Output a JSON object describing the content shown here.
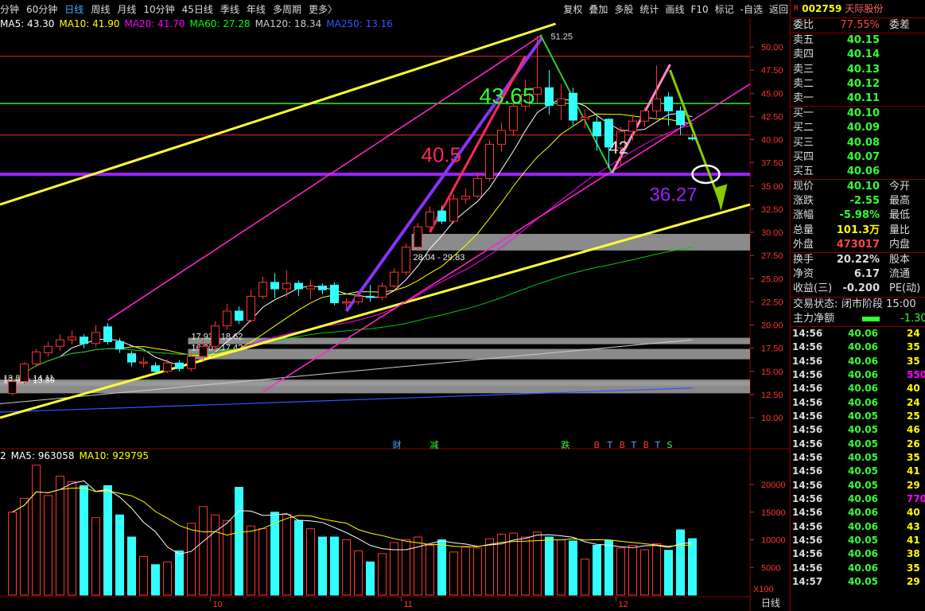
{
  "toolbar": {
    "periods": [
      "分钟",
      "60分钟",
      "日线",
      "周线",
      "月线",
      "10分钟",
      "45日线",
      "季线",
      "年线",
      "多周期",
      "更多〉"
    ],
    "active_period": "日线",
    "actions": [
      "复权",
      "叠加",
      "多股",
      "统计",
      "画线",
      "F10",
      "标记",
      "-自选",
      "返回"
    ]
  },
  "ma_legend": [
    {
      "label": "MA5: 43.30",
      "color": "#ffffff"
    },
    {
      "label": "MA10: 41.90",
      "color": "#ffff00"
    },
    {
      "label": "MA20: 41.70",
      "color": "#ff00ff"
    },
    {
      "label": "MA60: 27.28",
      "color": "#00ff00"
    },
    {
      "label": "MA120: 18.34",
      "color": "#cccccc"
    },
    {
      "label": "MA250: 13.16",
      "color": "#3355ff"
    }
  ],
  "vol_legend": [
    {
      "label": "2",
      "color": "#ffffff"
    },
    {
      "label": "MA5: 963058",
      "color": "#ffffff"
    },
    {
      "label": "MA10: 929795",
      "color": "#ffff00"
    }
  ],
  "chart_data": {
    "type": "candlestick",
    "price_axis": {
      "ticks": [
        10,
        12.5,
        15,
        17.5,
        20,
        22.5,
        25,
        27.5,
        30,
        32.5,
        35,
        37.5,
        40,
        42.5,
        45,
        47.5,
        50
      ],
      "tick_labels": [
        "10.00",
        "12.50",
        "15.00",
        "17.50",
        "20.00",
        "22.50",
        "25.00",
        "27.50",
        "30.00",
        "32.50",
        "35.00",
        "37.50",
        "40.00",
        "42.50",
        "45.00",
        "47.50",
        "50.00"
      ]
    },
    "volume_axis": {
      "ticks": [
        5000,
        10000,
        15000,
        20000
      ],
      "tick_labels": [
        "5000",
        "10000",
        "15000",
        "20000"
      ],
      "unit_label": "X100"
    },
    "x_labels": [
      {
        "label": "10",
        "index": 17
      },
      {
        "label": "11",
        "index": 33
      },
      {
        "label": "12",
        "index": 51
      }
    ],
    "period_label": "日线",
    "candles": [
      {
        "o": 12.6,
        "c": 13.9,
        "h": 14.2,
        "l": 12.4,
        "v": 15000
      },
      {
        "o": 13.9,
        "c": 15.8,
        "h": 16.0,
        "l": 13.6,
        "v": 17500
      },
      {
        "o": 15.8,
        "c": 17.1,
        "h": 17.4,
        "l": 15.5,
        "v": 23500
      },
      {
        "o": 17.0,
        "c": 17.7,
        "h": 18.2,
        "l": 16.6,
        "v": 18000
      },
      {
        "o": 17.7,
        "c": 18.4,
        "h": 19.0,
        "l": 17.2,
        "v": 21500
      },
      {
        "o": 18.4,
        "c": 18.7,
        "h": 19.4,
        "l": 17.9,
        "v": 20500
      },
      {
        "o": 18.7,
        "c": 18.0,
        "h": 19.0,
        "l": 17.5,
        "v": 19800
      },
      {
        "o": 18.0,
        "c": 19.2,
        "h": 20.0,
        "l": 17.6,
        "v": 14000
      },
      {
        "o": 19.8,
        "c": 18.2,
        "h": 20.2,
        "l": 17.9,
        "v": 19800
      },
      {
        "o": 18.2,
        "c": 17.4,
        "h": 18.6,
        "l": 17.0,
        "v": 14500
      },
      {
        "o": 16.9,
        "c": 16.0,
        "h": 17.2,
        "l": 15.5,
        "v": 10500
      },
      {
        "o": 16.0,
        "c": 16.0,
        "h": 16.5,
        "l": 15.4,
        "v": 7000
      },
      {
        "o": 15.6,
        "c": 15.0,
        "h": 16.0,
        "l": 14.9,
        "v": 5500
      },
      {
        "o": 15.0,
        "c": 15.9,
        "h": 16.3,
        "l": 14.8,
        "v": 6000
      },
      {
        "o": 15.9,
        "c": 15.3,
        "h": 16.2,
        "l": 15.0,
        "v": 8000
      },
      {
        "o": 15.3,
        "c": 16.6,
        "h": 17.1,
        "l": 15.0,
        "v": 13000
      },
      {
        "o": 16.6,
        "c": 17.7,
        "h": 18.4,
        "l": 16.1,
        "v": 16000
      },
      {
        "o": 17.7,
        "c": 19.9,
        "h": 20.4,
        "l": 17.3,
        "v": 14500
      },
      {
        "o": 19.9,
        "c": 21.5,
        "h": 22.3,
        "l": 19.5,
        "v": 13500
      },
      {
        "o": 21.5,
        "c": 20.5,
        "h": 22.0,
        "l": 20.1,
        "v": 19500
      },
      {
        "o": 20.5,
        "c": 23.1,
        "h": 23.8,
        "l": 20.3,
        "v": 12500
      },
      {
        "o": 23.1,
        "c": 24.6,
        "h": 25.2,
        "l": 22.8,
        "v": 12000
      },
      {
        "o": 24.6,
        "c": 23.9,
        "h": 25.6,
        "l": 22.9,
        "v": 15000
      },
      {
        "o": 23.9,
        "c": 24.5,
        "h": 25.9,
        "l": 23.0,
        "v": 14600
      },
      {
        "o": 24.5,
        "c": 23.9,
        "h": 24.8,
        "l": 23.1,
        "v": 13500
      },
      {
        "o": 23.9,
        "c": 24.2,
        "h": 24.9,
        "l": 22.8,
        "v": 12000
      },
      {
        "o": 24.2,
        "c": 23.8,
        "h": 24.5,
        "l": 23.3,
        "v": 10500
      },
      {
        "o": 24.3,
        "c": 22.4,
        "h": 24.6,
        "l": 22.1,
        "v": 10500
      },
      {
        "o": 22.4,
        "c": 22.5,
        "h": 22.9,
        "l": 21.7,
        "v": 10000
      },
      {
        "o": 22.5,
        "c": 23.1,
        "h": 23.6,
        "l": 22.2,
        "v": 8000
      },
      {
        "o": 23.1,
        "c": 23.0,
        "h": 24.3,
        "l": 22.5,
        "v": 6000
      },
      {
        "o": 23.0,
        "c": 24.2,
        "h": 24.6,
        "l": 22.7,
        "v": 7500
      },
      {
        "o": 24.2,
        "c": 25.7,
        "h": 26.1,
        "l": 24.0,
        "v": 9500
      },
      {
        "o": 25.7,
        "c": 28.4,
        "h": 28.8,
        "l": 25.4,
        "v": 10000
      },
      {
        "o": 28.4,
        "c": 30.6,
        "h": 31.0,
        "l": 28.1,
        "v": 10500
      },
      {
        "o": 30.6,
        "c": 32.2,
        "h": 32.8,
        "l": 30.3,
        "v": 9000
      },
      {
        "o": 32.3,
        "c": 31.2,
        "h": 32.9,
        "l": 30.9,
        "v": 10000
      },
      {
        "o": 31.2,
        "c": 33.6,
        "h": 34.1,
        "l": 31.0,
        "v": 7800
      },
      {
        "o": 33.6,
        "c": 33.9,
        "h": 34.7,
        "l": 33.1,
        "v": 8800
      },
      {
        "o": 33.9,
        "c": 35.8,
        "h": 36.4,
        "l": 33.7,
        "v": 8500
      },
      {
        "o": 35.8,
        "c": 39.5,
        "h": 40.0,
        "l": 35.5,
        "v": 10200
      },
      {
        "o": 39.5,
        "c": 41.0,
        "h": 41.8,
        "l": 38.7,
        "v": 11000
      },
      {
        "o": 41.0,
        "c": 43.6,
        "h": 44.7,
        "l": 40.4,
        "v": 11200
      },
      {
        "o": 43.6,
        "c": 44.9,
        "h": 46.5,
        "l": 43.1,
        "v": 10500
      },
      {
        "o": 44.9,
        "c": 45.6,
        "h": 51.2,
        "l": 44.0,
        "v": 11400
      },
      {
        "o": 45.6,
        "c": 43.7,
        "h": 47.5,
        "l": 42.7,
        "v": 10500
      },
      {
        "o": 43.7,
        "c": 44.4,
        "h": 46.0,
        "l": 42.1,
        "v": 10000
      },
      {
        "o": 45.0,
        "c": 42.1,
        "h": 45.6,
        "l": 41.6,
        "v": 9800
      },
      {
        "o": 42.2,
        "c": 42.4,
        "h": 43.3,
        "l": 41.2,
        "v": 6500
      },
      {
        "o": 41.9,
        "c": 40.4,
        "h": 42.5,
        "l": 38.8,
        "v": 9000
      },
      {
        "o": 42.2,
        "c": 39.2,
        "h": 42.3,
        "l": 36.9,
        "v": 9900
      },
      {
        "o": 39.1,
        "c": 40.9,
        "h": 41.4,
        "l": 37.3,
        "v": 8500
      },
      {
        "o": 40.9,
        "c": 42.0,
        "h": 42.7,
        "l": 39.9,
        "v": 9000
      },
      {
        "o": 42.0,
        "c": 43.1,
        "h": 43.5,
        "l": 41.4,
        "v": 8200
      },
      {
        "o": 43.1,
        "c": 44.4,
        "h": 48.0,
        "l": 42.4,
        "v": 9300
      },
      {
        "o": 44.6,
        "c": 43.1,
        "h": 45.1,
        "l": 41.5,
        "v": 8100
      },
      {
        "o": 43.1,
        "c": 41.6,
        "h": 43.6,
        "l": 40.5,
        "v": 11800
      },
      {
        "o": 40.2,
        "c": 40.1,
        "h": 40.6,
        "l": 39.9,
        "v": 10200
      }
    ],
    "zones": [
      {
        "label": "28.04 - 29.83",
        "low": 28.04,
        "high": 29.83
      },
      {
        "label": "17.93 - 18.62",
        "low": 17.93,
        "high": 18.62
      },
      {
        "label": "16.30 - 17.42",
        "low": 16.3,
        "high": 17.42
      },
      {
        "label": "13.89 - 14.11",
        "low": 13.89,
        "high": 14.11
      },
      {
        "label": "12.63 - 13.89",
        "low": 12.63,
        "high": 13.89
      }
    ],
    "horizontal_lines": [
      {
        "value": 43.9,
        "color": "#33ff33"
      },
      {
        "value": 36.27,
        "color": "#9922ff"
      },
      {
        "value": 40.5,
        "color": "#aa2222"
      },
      {
        "value": 49.0,
        "color": "#aa2222"
      }
    ],
    "annotations": [
      {
        "text": "43.65",
        "color": "#33ff33"
      },
      {
        "text": "40.5",
        "color": "#ff2a5a"
      },
      {
        "text": "42",
        "color": "#dddddd"
      },
      {
        "text": "36.27",
        "color": "#9922ff"
      },
      {
        "text": "51.25",
        "color": "#dddddd"
      }
    ],
    "event_markers": [
      {
        "text": "财",
        "color": "#4af"
      },
      {
        "text": "减",
        "color": "#3f3"
      },
      {
        "text": "跌",
        "color": "#3f3"
      },
      {
        "text": "B",
        "color": "#f33"
      },
      {
        "text": "T",
        "color": "#4af"
      },
      {
        "text": "B",
        "color": "#f33"
      },
      {
        "text": "T",
        "color": "#4af"
      },
      {
        "text": "B",
        "color": "#f33"
      },
      {
        "text": "T",
        "color": "#4af"
      },
      {
        "text": "S",
        "color": "#3f3"
      }
    ]
  },
  "right_panel": {
    "code": "002759",
    "name": "天际股份",
    "r_badge": "R",
    "webi": {
      "label": "委比",
      "value": "77.55%",
      "label2": "委差"
    },
    "asks": [
      {
        "label": "卖五",
        "price": "40.15"
      },
      {
        "label": "卖四",
        "price": "40.14"
      },
      {
        "label": "卖三",
        "price": "40.13"
      },
      {
        "label": "卖二",
        "price": "40.12"
      },
      {
        "label": "卖一",
        "price": "40.11"
      }
    ],
    "bids": [
      {
        "label": "买一",
        "price": "40.10"
      },
      {
        "label": "买二",
        "price": "40.09"
      },
      {
        "label": "买三",
        "price": "40.08"
      },
      {
        "label": "买四",
        "price": "40.07"
      },
      {
        "label": "买五",
        "price": "40.06"
      }
    ],
    "stats": [
      {
        "label": "现价",
        "value": "40.10",
        "label2": "今开",
        "color": "#3f3"
      },
      {
        "label": "涨跌",
        "value": "-2.55",
        "label2": "最高",
        "color": "#3f3"
      },
      {
        "label": "涨幅",
        "value": "-5.98%",
        "label2": "最低",
        "color": "#3f3"
      },
      {
        "label": "总量",
        "value": "101.3万",
        "label2": "量比",
        "color": "#ff0"
      },
      {
        "label": "外盘",
        "value": "473017",
        "label2": "内盘",
        "color": "#f44"
      }
    ],
    "stats2": [
      {
        "label": "换手",
        "value": "20.22%",
        "label2": "股本",
        "color": "#ddd"
      },
      {
        "label": "净资",
        "value": "6.17",
        "label2": "流通",
        "color": "#ddd"
      },
      {
        "label": "收益(三)",
        "value": "-0.200",
        "label2": "PE(动)",
        "color": "#ddd"
      }
    ],
    "status": {
      "label": "交易状态:",
      "value": "闭市阶段 15:00"
    },
    "net_flow": {
      "label": "主力净额",
      "value": "-1.30"
    },
    "ticks": [
      {
        "t": "14:56",
        "p": "40.06",
        "q": "24"
      },
      {
        "t": "14:56",
        "p": "40.06",
        "q": "35"
      },
      {
        "t": "14:56",
        "p": "40.06",
        "q": "35"
      },
      {
        "t": "14:56",
        "p": "40.06",
        "q": "550"
      },
      {
        "t": "14:56",
        "p": "40.06",
        "q": "40"
      },
      {
        "t": "14:56",
        "p": "40.06",
        "q": "24"
      },
      {
        "t": "14:56",
        "p": "40.05",
        "q": "25"
      },
      {
        "t": "14:56",
        "p": "40.05",
        "q": "46"
      },
      {
        "t": "14:56",
        "p": "40.05",
        "q": "26"
      },
      {
        "t": "14:56",
        "p": "40.05",
        "q": "35"
      },
      {
        "t": "14:56",
        "p": "40.05",
        "q": "41"
      },
      {
        "t": "14:56",
        "p": "40.05",
        "q": "29"
      },
      {
        "t": "14:56",
        "p": "40.06",
        "q": "770"
      },
      {
        "t": "14:56",
        "p": "40.06",
        "q": "40"
      },
      {
        "t": "14:56",
        "p": "40.06",
        "q": "43"
      },
      {
        "t": "14:56",
        "p": "40.05",
        "q": "41"
      },
      {
        "t": "14:56",
        "p": "40.06",
        "q": "38"
      },
      {
        "t": "14:56",
        "p": "40.06",
        "q": "35"
      },
      {
        "t": "14:57",
        "p": "40.05",
        "q": "29"
      }
    ]
  }
}
